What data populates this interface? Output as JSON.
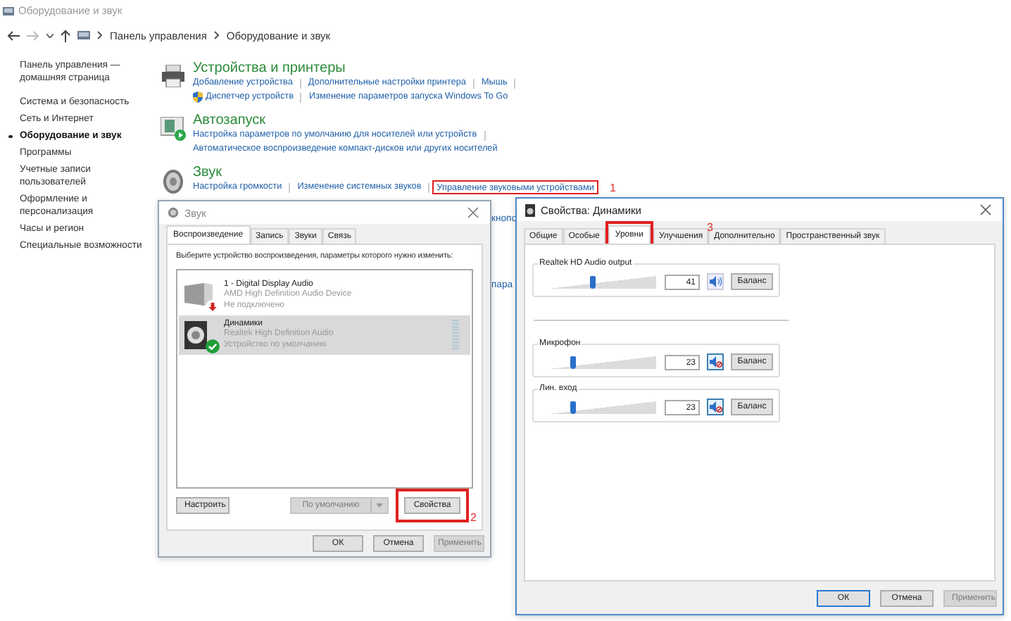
{
  "window": {
    "title": "Оборудование и звук"
  },
  "breadcrumb": [
    "Панель управления",
    "Оборудование и звук"
  ],
  "sidebar": {
    "items": [
      {
        "label": "Панель управления — домашняя страница",
        "selected": false
      },
      {
        "label": "Система и безопасность",
        "selected": false
      },
      {
        "label": "Сеть и Интернет",
        "selected": false
      },
      {
        "label": "Оборудование и звук",
        "selected": true
      },
      {
        "label": "Программы",
        "selected": false
      },
      {
        "label": "Учетные записи пользователей",
        "selected": false
      },
      {
        "label": "Оформление и персонализация",
        "selected": false
      },
      {
        "label": "Часы и регион",
        "selected": false
      },
      {
        "label": "Специальные возможности",
        "selected": false
      }
    ]
  },
  "categories": [
    {
      "kind": "printer",
      "title": "Устройства и принтеры",
      "link_rows": [
        [
          {
            "label": "Добавление устройства",
            "shield": false,
            "highlighted": false
          },
          {
            "label": "Дополнительные настройки принтера",
            "shield": false,
            "highlighted": false
          },
          {
            "label": "Мышь",
            "shield": false,
            "highlighted": false
          }
        ],
        [
          {
            "label": "Диспетчер устройств",
            "shield": true,
            "highlighted": false
          },
          {
            "label": "Изменение параметров запуска Windows To Go",
            "shield": false,
            "highlighted": false
          }
        ]
      ]
    },
    {
      "kind": "autoplay",
      "title": "Автозапуск",
      "link_rows": [
        [
          {
            "label": "Настройка параметров по умолчанию для носителей или устройств",
            "shield": false,
            "highlighted": false
          }
        ],
        [
          {
            "label": "Автоматическое воспроизведение компакт-дисков или других носителей",
            "shield": false,
            "highlighted": false
          }
        ]
      ]
    },
    {
      "kind": "sound",
      "title": "Звук",
      "link_rows": [
        [
          {
            "label": "Настройка громкости",
            "shield": false,
            "highlighted": false
          },
          {
            "label": "Изменение системных звуков",
            "shield": false,
            "highlighted": false
          },
          {
            "label": "Управление звуковыми устройствами",
            "shield": false,
            "highlighted": true,
            "marker": "1"
          }
        ]
      ]
    }
  ],
  "hidden_link_fragments": [
    "кнопо",
    "пара"
  ],
  "sound_dialog": {
    "title": "Звук",
    "tabs": [
      {
        "label": "Воспроизведение",
        "selected": true
      },
      {
        "label": "Запись",
        "selected": false
      },
      {
        "label": "Звуки",
        "selected": false
      },
      {
        "label": "Связь",
        "selected": false
      }
    ],
    "instruction": "Выберите устройство воспроизведения, параметры которого нужно изменить:",
    "devices": [
      {
        "kind": "monitor",
        "name": "1 - Digital Display Audio",
        "driver": "AMD High Definition Audio Device",
        "status": "Не подключено",
        "default": false,
        "selected": false
      },
      {
        "kind": "speaker",
        "name": "Динамики",
        "driver": "Realtek High Definition Audio",
        "status": "Устройство по умолчанию",
        "default": true,
        "selected": true
      }
    ],
    "buttons": [
      {
        "kind": "plain",
        "label": "Настроить",
        "disabled": false,
        "highlighted": false
      },
      {
        "kind": "split",
        "label": "По умолчанию",
        "disabled": true,
        "highlighted": false
      },
      {
        "kind": "plain",
        "label": "Свойства",
        "disabled": false,
        "highlighted": true,
        "marker": "2"
      }
    ],
    "footer_buttons": [
      {
        "label": "ОК",
        "disabled": false
      },
      {
        "label": "Отмена",
        "disabled": false
      },
      {
        "label": "Применить",
        "disabled": true
      }
    ]
  },
  "properties_dialog": {
    "title": "Свойства: Динамики",
    "tabs": [
      {
        "label": "Общие",
        "selected": false,
        "highlighted": false
      },
      {
        "label": "Особые",
        "selected": false,
        "highlighted": false
      },
      {
        "label": "Уровни",
        "selected": true,
        "highlighted": true,
        "marker": "3"
      },
      {
        "label": "Улучшения",
        "selected": false,
        "highlighted": false
      },
      {
        "label": "Дополнительно",
        "selected": false,
        "highlighted": false
      },
      {
        "label": "Пространственный звук",
        "selected": false,
        "highlighted": false
      }
    ],
    "channels": [
      {
        "name": "Realtek HD Audio output",
        "level": 0.41,
        "value": "41",
        "muted": false,
        "balance": "Баланс"
      },
      {
        "name": "Микрофон",
        "level": 0.23,
        "value": "23",
        "muted": true,
        "balance": "Баланс"
      },
      {
        "name": "Лин. вход",
        "level": 0.23,
        "value": "23",
        "muted": true,
        "balance": "Баланс"
      }
    ],
    "footer_buttons": [
      {
        "label": "ОК",
        "disabled": false,
        "default": true
      },
      {
        "label": "Отмена",
        "disabled": false,
        "default": false
      },
      {
        "label": "Применить",
        "disabled": true,
        "default": false
      }
    ]
  }
}
